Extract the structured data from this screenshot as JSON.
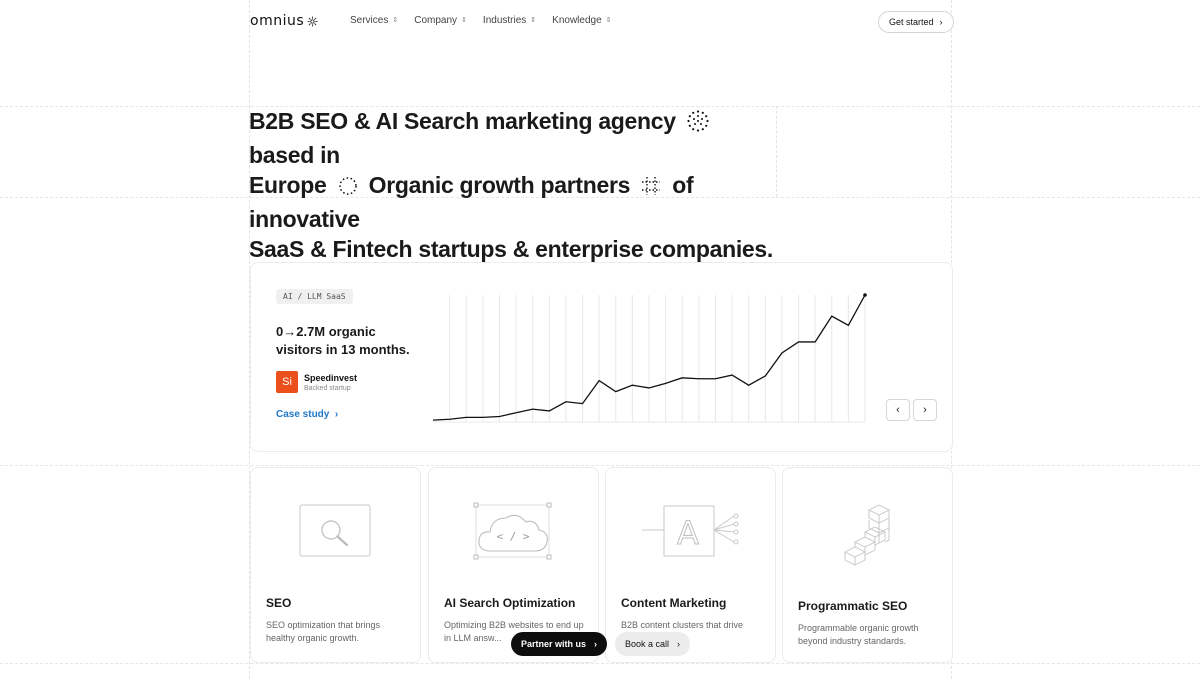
{
  "nav": {
    "logo_text": "omnius",
    "menu": [
      {
        "label": "Services"
      },
      {
        "label": "Company"
      },
      {
        "label": "Industries"
      },
      {
        "label": "Knowledge"
      }
    ],
    "cta_label": "Get started"
  },
  "hero": {
    "line1_a": "B2B SEO & AI Search marketing agency",
    "line1_b": "based in",
    "line2_a": "Europe",
    "line2_b": "Organic growth partners",
    "line2_c": "of innovative",
    "line3": "SaaS & Fintech startups & enterprise companies."
  },
  "case": {
    "tag": "AI / LLM SaaS",
    "headline_a": "0→2.7M organic",
    "headline_b": "visitors in 13 months.",
    "client_initials": "Si",
    "client_name": "Speedinvest",
    "client_sub": "Backed startup",
    "link_label": "Case study",
    "chart_data": {
      "type": "line",
      "values": [
        0.02,
        0.03,
        0.05,
        0.05,
        0.06,
        0.1,
        0.14,
        0.12,
        0.22,
        0.2,
        0.45,
        0.33,
        0.4,
        0.37,
        0.42,
        0.48,
        0.47,
        0.47,
        0.51,
        0.4,
        0.5,
        0.75,
        0.87,
        0.87,
        1.15,
        1.05,
        1.38
      ],
      "accent": "#111111",
      "grid": true
    }
  },
  "services": [
    {
      "title": "SEO",
      "desc": "SEO optimization that brings healthy organic growth."
    },
    {
      "title": "AI Search Optimization",
      "desc": "Optimizing B2B websites to end up in LLM answ..."
    },
    {
      "title": "Content Marketing",
      "desc": "B2B content clusters that drive ...isition."
    },
    {
      "title": "Programmatic SEO",
      "desc": "Programmable organic growth beyond industry standards."
    }
  ],
  "cta": {
    "primary": "Partner with us",
    "secondary": "Book a call"
  }
}
